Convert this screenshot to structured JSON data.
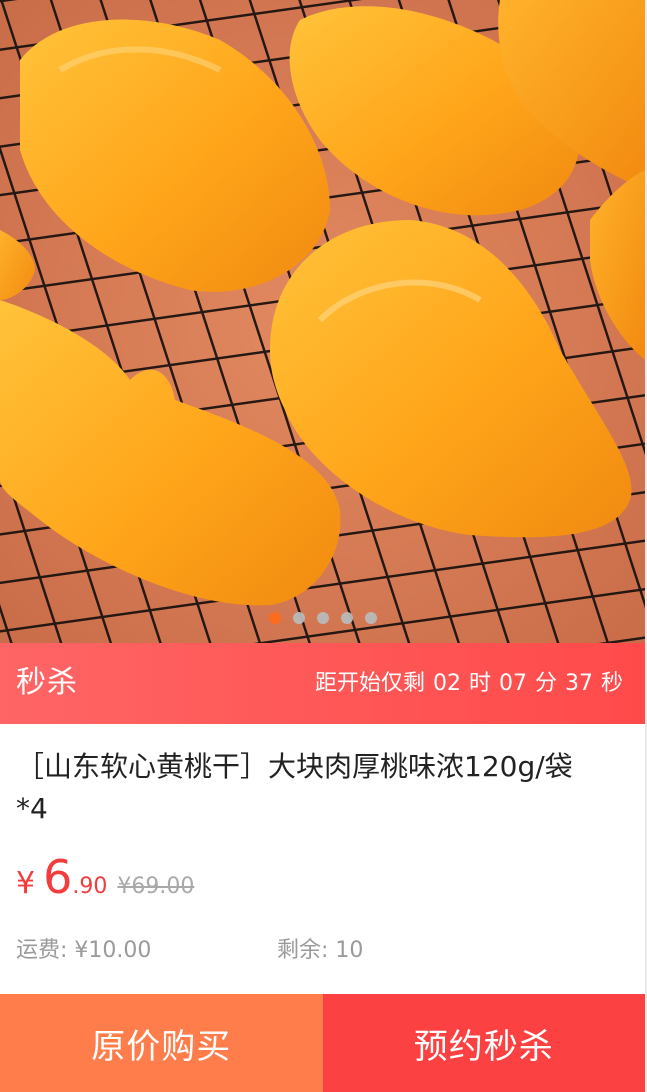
{
  "carousel": {
    "image_subject": "dried yellow peach slices on black wire cooling rack",
    "slide_count": 5,
    "active_index": 0
  },
  "flash_sale": {
    "title": "秒杀",
    "countdown_prefix": "距开始仅剩",
    "hours": "02",
    "hours_unit": "时",
    "minutes": "07",
    "minutes_unit": "分",
    "seconds": "37",
    "seconds_unit": "秒"
  },
  "product": {
    "title": "［山东软心黄桃干］大块肉厚桃味浓120g/袋*4",
    "currency": "¥",
    "price_int": "6",
    "price_dec": ".90",
    "original_price": "¥69.00",
    "shipping": "运费: ¥10.00",
    "stock": "剩余: 10"
  },
  "actions": {
    "buy_label": "原价购买",
    "reserve_label": "预约秒杀"
  },
  "colors": {
    "flash_bar": "#ff5a5a",
    "price": "#f33d3d",
    "buy_button": "#ff7d4b",
    "reserve_button": "#fb4141",
    "active_dot": "#ff6a1a"
  }
}
